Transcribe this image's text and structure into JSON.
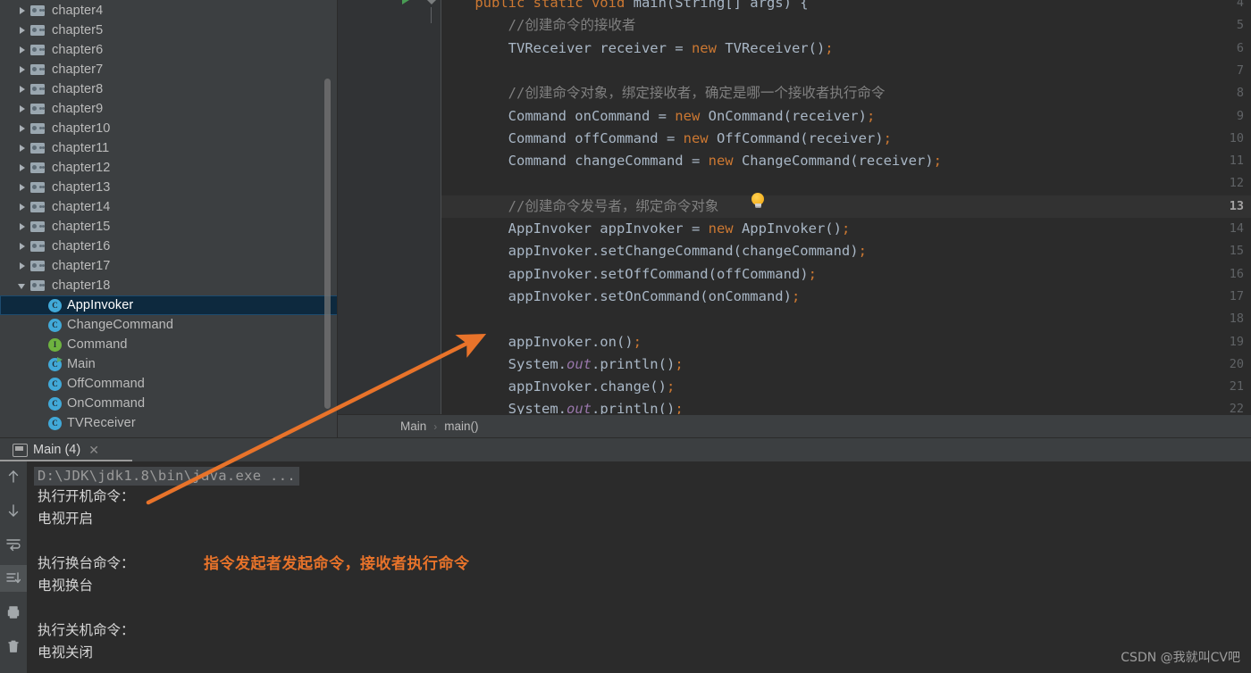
{
  "project_tree": {
    "items": [
      {
        "label": "chapter4",
        "type": "folder",
        "state": "collapsed",
        "indent": 0,
        "selected": false
      },
      {
        "label": "chapter5",
        "type": "folder",
        "state": "collapsed",
        "indent": 0,
        "selected": false
      },
      {
        "label": "chapter6",
        "type": "folder",
        "state": "collapsed",
        "indent": 0,
        "selected": false
      },
      {
        "label": "chapter7",
        "type": "folder",
        "state": "collapsed",
        "indent": 0,
        "selected": false
      },
      {
        "label": "chapter8",
        "type": "folder",
        "state": "collapsed",
        "indent": 0,
        "selected": false
      },
      {
        "label": "chapter9",
        "type": "folder",
        "state": "collapsed",
        "indent": 0,
        "selected": false
      },
      {
        "label": "chapter10",
        "type": "folder",
        "state": "collapsed",
        "indent": 0,
        "selected": false
      },
      {
        "label": "chapter11",
        "type": "folder",
        "state": "collapsed",
        "indent": 0,
        "selected": false
      },
      {
        "label": "chapter12",
        "type": "folder",
        "state": "collapsed",
        "indent": 0,
        "selected": false
      },
      {
        "label": "chapter13",
        "type": "folder",
        "state": "collapsed",
        "indent": 0,
        "selected": false
      },
      {
        "label": "chapter14",
        "type": "folder",
        "state": "collapsed",
        "indent": 0,
        "selected": false
      },
      {
        "label": "chapter15",
        "type": "folder",
        "state": "collapsed",
        "indent": 0,
        "selected": false
      },
      {
        "label": "chapter16",
        "type": "folder",
        "state": "collapsed",
        "indent": 0,
        "selected": false
      },
      {
        "label": "chapter17",
        "type": "folder",
        "state": "collapsed",
        "indent": 0,
        "selected": false
      },
      {
        "label": "chapter18",
        "type": "folder",
        "state": "expanded",
        "indent": 0,
        "selected": false
      },
      {
        "label": "AppInvoker",
        "type": "class",
        "indent": 1,
        "selected": true
      },
      {
        "label": "ChangeCommand",
        "type": "class",
        "indent": 1,
        "selected": false
      },
      {
        "label": "Command",
        "type": "interface",
        "indent": 1,
        "selected": false
      },
      {
        "label": "Main",
        "type": "class-runnable",
        "indent": 1,
        "selected": false
      },
      {
        "label": "OffCommand",
        "type": "class",
        "indent": 1,
        "selected": false
      },
      {
        "label": "OnCommand",
        "type": "class",
        "indent": 1,
        "selected": false
      },
      {
        "label": "TVReceiver",
        "type": "class",
        "indent": 1,
        "selected": false
      }
    ],
    "icon_names": {
      "collapsed": "chevron-right-icon",
      "expanded": "chevron-down-icon",
      "folder": "folder-icon",
      "class": "class-c-icon",
      "interface": "interface-i-icon",
      "class-runnable": "class-c-runnable-icon"
    }
  },
  "editor": {
    "current_line": 13,
    "lines": [
      {
        "n": 4,
        "segments": [
          {
            "t": "public static void ",
            "c": "kw"
          },
          {
            "t": "main",
            "c": "mth"
          },
          {
            "t": "(String[] args) {",
            "c": "plain"
          }
        ],
        "indent": 4
      },
      {
        "n": 5,
        "segments": [
          {
            "t": "//创建命令的接收者",
            "c": "cmt"
          }
        ],
        "indent": 8
      },
      {
        "n": 6,
        "segments": [
          {
            "t": "TVReceiver receiver = ",
            "c": "plain"
          },
          {
            "t": "new",
            "c": "kw"
          },
          {
            "t": " TVReceiver()",
            "c": "plain"
          },
          {
            "t": ";",
            "c": "semi"
          }
        ],
        "indent": 8
      },
      {
        "n": 7,
        "segments": [],
        "indent": 8
      },
      {
        "n": 8,
        "segments": [
          {
            "t": "//创建命令对象，绑定接收者，确定是哪一个接收者执行命令",
            "c": "cmt"
          }
        ],
        "indent": 8
      },
      {
        "n": 9,
        "segments": [
          {
            "t": "Command onCommand = ",
            "c": "plain"
          },
          {
            "t": "new",
            "c": "kw"
          },
          {
            "t": " OnCommand(receiver)",
            "c": "plain"
          },
          {
            "t": ";",
            "c": "semi"
          }
        ],
        "indent": 8
      },
      {
        "n": 10,
        "segments": [
          {
            "t": "Command offCommand = ",
            "c": "plain"
          },
          {
            "t": "new",
            "c": "kw"
          },
          {
            "t": " OffCommand(receiver)",
            "c": "plain"
          },
          {
            "t": ";",
            "c": "semi"
          }
        ],
        "indent": 8
      },
      {
        "n": 11,
        "segments": [
          {
            "t": "Command changeCommand = ",
            "c": "plain"
          },
          {
            "t": "new",
            "c": "kw"
          },
          {
            "t": " ChangeCommand(receiver)",
            "c": "plain"
          },
          {
            "t": ";",
            "c": "semi"
          }
        ],
        "indent": 8
      },
      {
        "n": 12,
        "segments": [],
        "indent": 8
      },
      {
        "n": 13,
        "segments": [
          {
            "t": "//创建命令发号者，绑定命令对象",
            "c": "cmt"
          }
        ],
        "indent": 8
      },
      {
        "n": 14,
        "segments": [
          {
            "t": "AppInvoker appInvoker = ",
            "c": "plain"
          },
          {
            "t": "new",
            "c": "kw"
          },
          {
            "t": " AppInvoker()",
            "c": "plain"
          },
          {
            "t": ";",
            "c": "semi"
          }
        ],
        "indent": 8
      },
      {
        "n": 15,
        "segments": [
          {
            "t": "appInvoker.setChangeCommand(changeCommand)",
            "c": "plain"
          },
          {
            "t": ";",
            "c": "semi"
          }
        ],
        "indent": 8
      },
      {
        "n": 16,
        "segments": [
          {
            "t": "appInvoker.setOffCommand(offCommand)",
            "c": "plain"
          },
          {
            "t": ";",
            "c": "semi"
          }
        ],
        "indent": 8
      },
      {
        "n": 17,
        "segments": [
          {
            "t": "appInvoker.setOnCommand(onCommand)",
            "c": "plain"
          },
          {
            "t": ";",
            "c": "semi"
          }
        ],
        "indent": 8
      },
      {
        "n": 18,
        "segments": [],
        "indent": 8
      },
      {
        "n": 19,
        "segments": [
          {
            "t": "appInvoker.on()",
            "c": "plain"
          },
          {
            "t": ";",
            "c": "semi"
          }
        ],
        "indent": 8
      },
      {
        "n": 20,
        "segments": [
          {
            "t": "System.",
            "c": "plain"
          },
          {
            "t": "out",
            "c": "fld"
          },
          {
            "t": ".println()",
            "c": "plain"
          },
          {
            "t": ";",
            "c": "semi"
          }
        ],
        "indent": 8
      },
      {
        "n": 21,
        "segments": [
          {
            "t": "appInvoker.change()",
            "c": "plain"
          },
          {
            "t": ";",
            "c": "semi"
          }
        ],
        "indent": 8
      },
      {
        "n": 22,
        "segments": [
          {
            "t": "System.",
            "c": "plain"
          },
          {
            "t": "out",
            "c": "fld"
          },
          {
            "t": ".println()",
            "c": "plain"
          },
          {
            "t": ";",
            "c": "semi"
          }
        ],
        "indent": 8
      }
    ],
    "gutter_icons": {
      "run": "run-triangle-icon",
      "fold": "fold-collapse-icon",
      "intention": "lightbulb-icon"
    }
  },
  "breadcrumb": {
    "items": [
      "Main",
      "main()"
    ],
    "separator": "›"
  },
  "run_console": {
    "tab_label": "Main (4)",
    "tab_icon": "run-window-icon",
    "close_icon": "close-icon",
    "toolbar": [
      {
        "name": "up-arrow-icon",
        "label": "Up the stack trace",
        "active": false
      },
      {
        "name": "down-arrow-icon",
        "label": "Down the stack trace",
        "active": false
      },
      {
        "name": "soft-wrap-icon",
        "label": "Soft-Wrap",
        "active": false
      },
      {
        "name": "scroll-to-end-icon",
        "label": "Scroll to end",
        "active": true
      },
      {
        "name": "print-icon",
        "label": "Print",
        "active": false
      },
      {
        "name": "trash-icon",
        "label": "Clear All",
        "active": false
      }
    ],
    "command_line": "D:\\JDK\\jdk1.8\\bin\\java.exe ...",
    "output": [
      "执行开机命令：",
      "电视开启",
      "",
      "执行换台命令：",
      "电视换台",
      "",
      "执行关机命令：",
      "电视关闭"
    ]
  },
  "annotation": {
    "text": "指令发起者发起命令，接收者执行命令",
    "color": "#e8732a",
    "arrow_name": "annotation-arrow"
  },
  "watermark": {
    "text": "CSDN @我就叫CV吧"
  },
  "colors": {
    "ide_background": "#3c3f41",
    "editor_background": "#2b2b2b",
    "gutter_background": "#313335",
    "selection_blue": "#0d293e",
    "keyword_orange": "#cc7832",
    "comment_gray": "#808080",
    "code_foreground": "#a9b7c6",
    "annotation_orange": "#e8732a"
  }
}
